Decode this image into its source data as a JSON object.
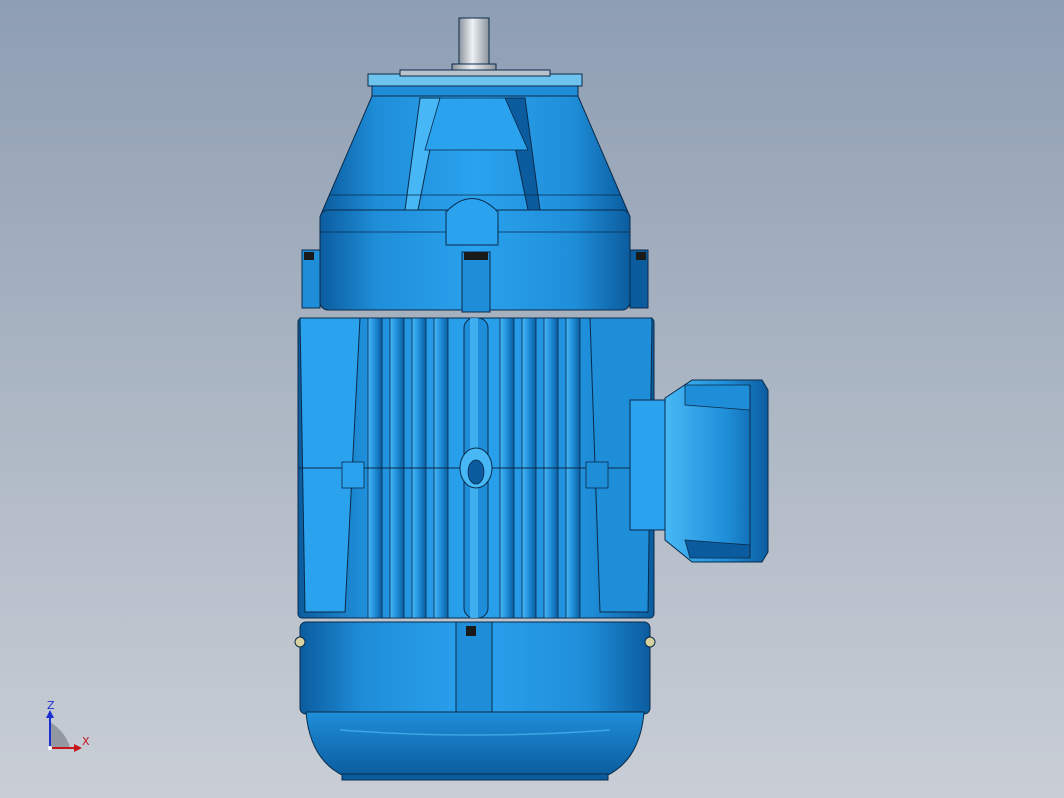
{
  "viewport": {
    "background_top": "#8e9eb3",
    "background_bottom": "#c9ced6"
  },
  "model": {
    "body_color": "#1f8ed9",
    "shadow_color": "#0b5c9e",
    "highlight_color": "#47b8f5",
    "edge_color": "#0a2a4a",
    "shaft_color": "#c7cdd3"
  },
  "triad": {
    "z_label": "Z",
    "x_label": "X",
    "z_color": "#1b2fd0",
    "x_color": "#c4161c"
  }
}
